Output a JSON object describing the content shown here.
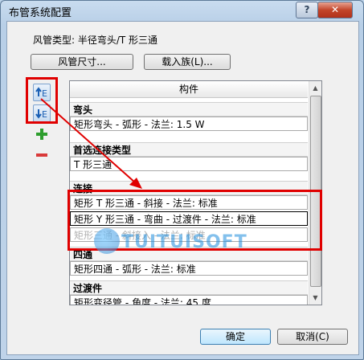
{
  "window": {
    "title": "布管系统配置",
    "help_label": "?",
    "close_label": "✕"
  },
  "type_label": "风管类型: 半径弯头/T 形三通",
  "buttons": {
    "duct_size": "风管尺寸...",
    "load_family": "载入族(L)...",
    "ok": "确定",
    "cancel": "取消(C)"
  },
  "table": {
    "header": "构件",
    "rows": [
      {
        "kind": "group",
        "text": "弯头"
      },
      {
        "kind": "item",
        "text": "矩形弯头 - 弧形 - 法兰: 1.5 W"
      },
      {
        "kind": "group",
        "text": "首选连接类型"
      },
      {
        "kind": "item",
        "text": "T 形三通"
      },
      {
        "kind": "group",
        "text": "连接"
      },
      {
        "kind": "item",
        "text": "矩形 T 形三通 - 斜接 - 法兰: 标准"
      },
      {
        "kind": "item",
        "text": "矩形 Y 形三通 - 弯曲 - 过渡件 - 法兰: 标准"
      },
      {
        "kind": "item",
        "text": "矩形三通 - 斜接入 - 法兰: 标准"
      },
      {
        "kind": "group",
        "text": "四通"
      },
      {
        "kind": "item",
        "text": "矩形四通 - 弧形 - 法兰: 标准"
      },
      {
        "kind": "group",
        "text": "过渡件"
      },
      {
        "kind": "item",
        "text": "矩形变径管 - 角度 - 法兰: 45 度"
      }
    ]
  },
  "watermark": "TUITUISOFT",
  "colors": {
    "annotation_red": "#e00000",
    "add_green": "#2e9e2e",
    "remove_red": "#d93a3a"
  }
}
